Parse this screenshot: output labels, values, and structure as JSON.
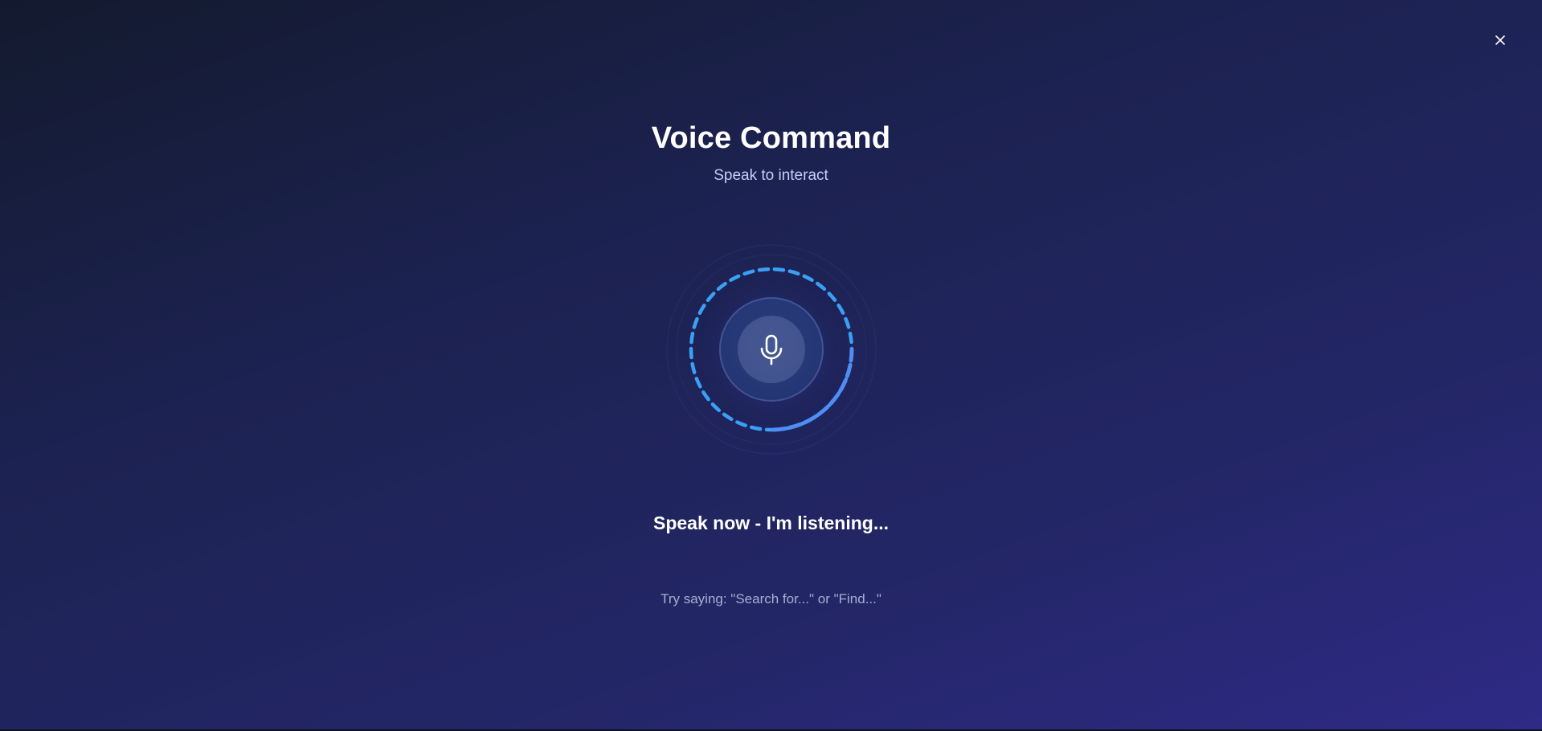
{
  "window": {
    "close_icon": "close-icon"
  },
  "header": {
    "title": "Voice Command",
    "subtitle": "Speak to interact"
  },
  "mic": {
    "icon": "microphone-icon",
    "state": "listening",
    "ring_color": "#3aa0f5",
    "ring_accent_color": "#4f8df5"
  },
  "status": {
    "text": "Speak now - I'm listening..."
  },
  "hint": {
    "text": "Try saying: \"Search for...\" or \"Find...\""
  },
  "colors": {
    "background_start": "#131a2e",
    "background_end": "#2e2a86",
    "subtitle": "#c8ccf5",
    "hint": "#a9aed4"
  }
}
